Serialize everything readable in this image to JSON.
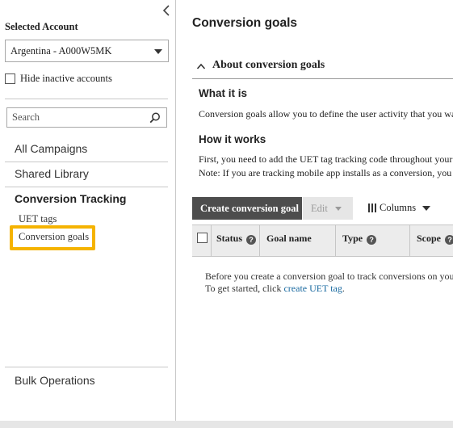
{
  "sidebar": {
    "account_label": "Selected Account",
    "account_value": "Argentina - A000W5MK",
    "hide_inactive": "Hide inactive accounts",
    "search_placeholder": "Search",
    "nav": {
      "all_campaigns": "All Campaigns",
      "shared_library": "Shared Library",
      "conversion_tracking": "Conversion Tracking",
      "uet_tags": "UET tags",
      "conversion_goals": "Conversion goals",
      "bulk_operations": "Bulk Operations"
    },
    "highlight_color": "#f5b300"
  },
  "main": {
    "title": "Conversion goals",
    "about_title": "About conversion goals",
    "what_heading": "What it is",
    "what_text": "Conversion goals allow you to define the user activity that you want to track",
    "how_heading": "How it works",
    "how_text_1": "First, you need to add the UET tag tracking code throughout your website",
    "how_text_2": "Note: If you are tracking mobile app installs as a conversion, you",
    "toolbar": {
      "create": "Create conversion goal",
      "edit": "Edit",
      "columns": "Columns"
    },
    "grid": {
      "columns": [
        "Status",
        "Goal name",
        "Type",
        "Scope"
      ]
    },
    "empty": {
      "line1": "Before you create a conversion goal to track conversions on your",
      "line2_prefix": "To get started, click ",
      "line2_link": "create UET tag",
      "line2_suffix": "."
    }
  }
}
